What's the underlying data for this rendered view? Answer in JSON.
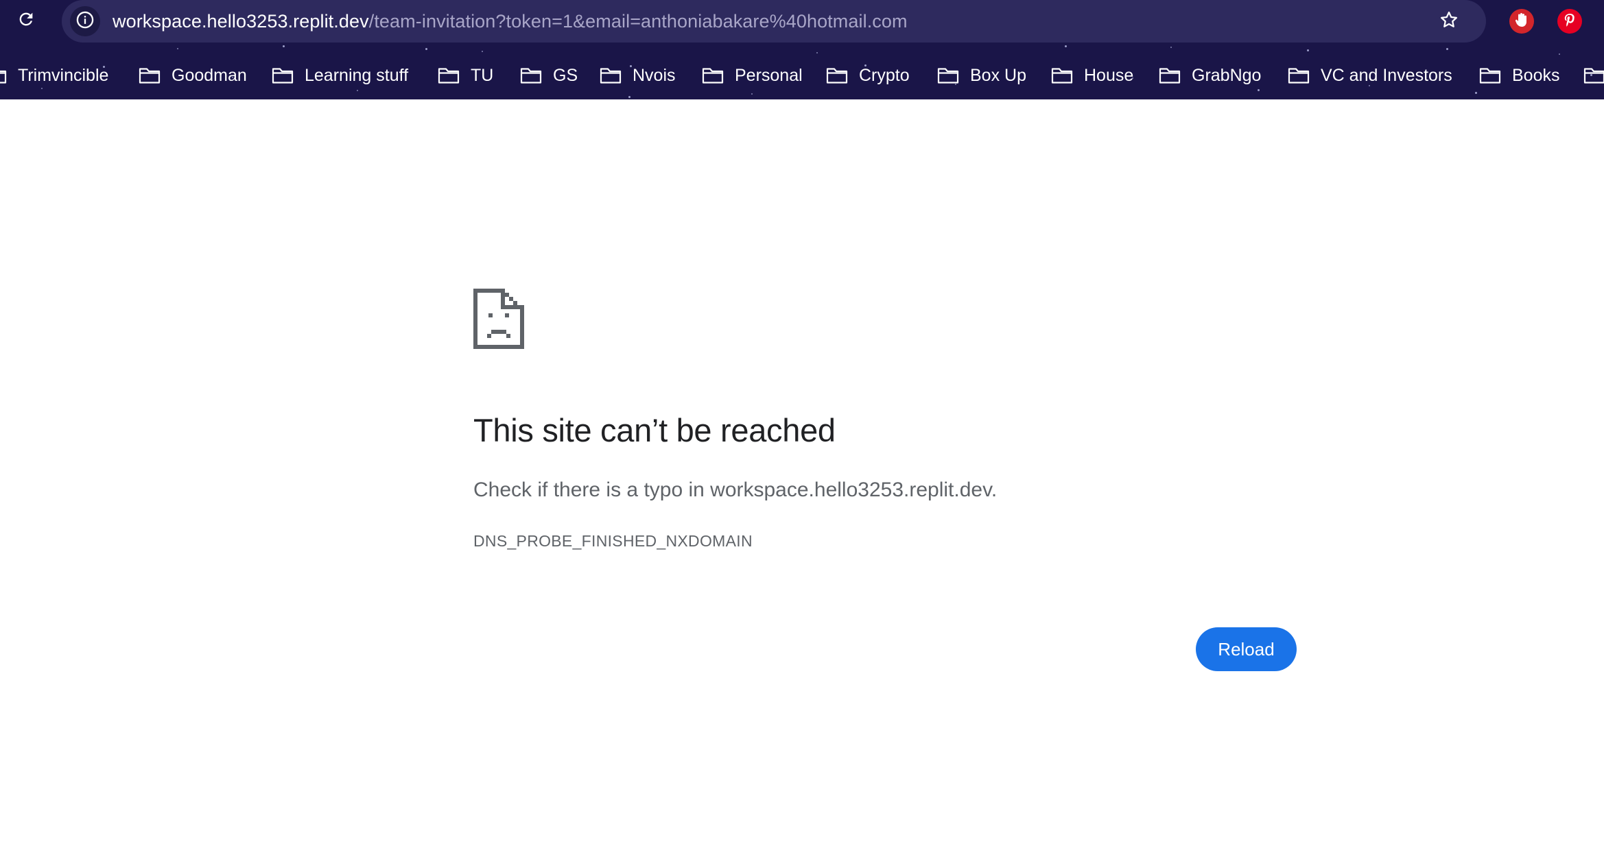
{
  "browser": {
    "url_host": "workspace.hello3253.replit.dev",
    "url_path": "/team-invitation?token=1&email=anthoniabakare%40hotmail.com",
    "icons": {
      "reload": "reload-icon",
      "site_info": "info-icon",
      "bookmark": "star-icon",
      "extension_1": "stop-hand-icon",
      "extension_2": "pinterest-icon"
    }
  },
  "bookmarks": [
    {
      "label": "Trimvincible"
    },
    {
      "label": "Goodman"
    },
    {
      "label": "Learning stuff"
    },
    {
      "label": "TU"
    },
    {
      "label": "GS"
    },
    {
      "label": "Nvois"
    },
    {
      "label": "Personal"
    },
    {
      "label": "Crypto"
    },
    {
      "label": "Box Up"
    },
    {
      "label": "House"
    },
    {
      "label": "GrabNgo"
    },
    {
      "label": "VC and Investors"
    },
    {
      "label": "Books"
    },
    {
      "label": ""
    }
  ],
  "error": {
    "icon": "sad-document-icon",
    "title": "This site can’t be reached",
    "message": "Check if there is a typo in workspace.hello3253.replit.dev.",
    "code": "DNS_PROBE_FINISHED_NXDOMAIN",
    "reload_label": "Reload"
  },
  "colors": {
    "chrome_background": "#1a1548",
    "omnibox_background": "#2e2a5e",
    "primary_button": "#1a73e8",
    "title_text": "#202124",
    "secondary_text": "#5f6368"
  }
}
